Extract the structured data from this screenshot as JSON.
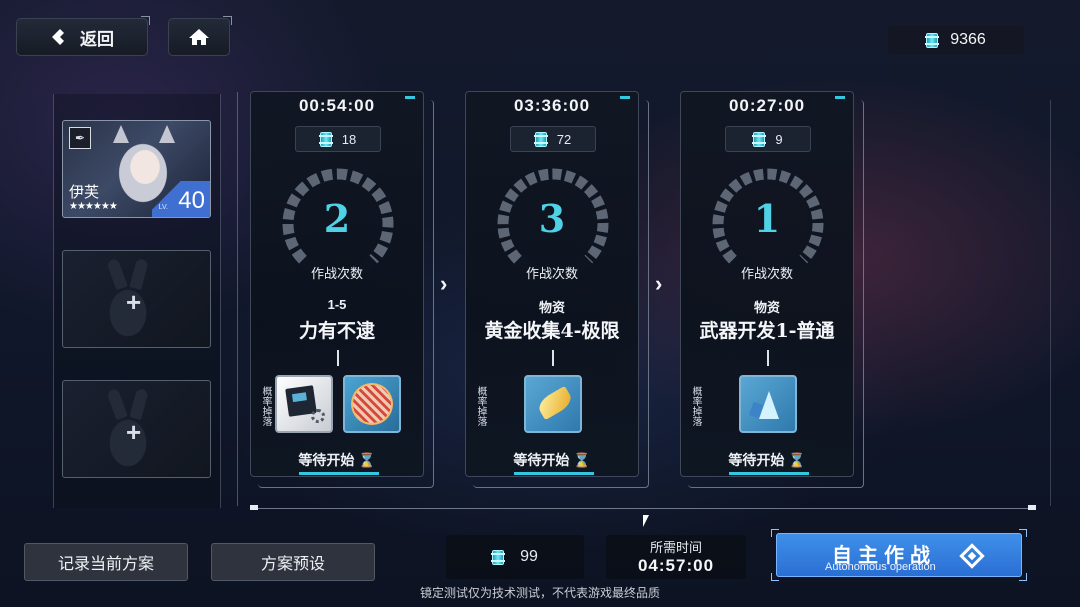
{
  "header": {
    "back_label": "返回",
    "back_icon": "diamond-back-icon",
    "home_icon": "home-icon",
    "currency_icon": "battery-can-icon",
    "currency_value": "9366"
  },
  "team": {
    "member": {
      "name": "伊芙",
      "level": "40",
      "lv_label": "LV.",
      "stars": "★★★★★★"
    },
    "empty_slot_label": "+"
  },
  "missions": [
    {
      "timer": "00:54:00",
      "cost": "18",
      "count": "2",
      "count_label": "作战次数",
      "stage_code": "1-5",
      "stage_name": "力有不逮",
      "drop_label": "概率掉落",
      "drops": [
        "gear-pad-icon",
        "red-chip-icon"
      ],
      "status": "等待开始"
    },
    {
      "timer": "03:36:00",
      "cost": "72",
      "count": "3",
      "count_label": "作战次数",
      "stage_code": "物资",
      "stage_name": "黄金收集4-极限",
      "drop_label": "概率掉落",
      "drops": [
        "gold-leaf-icon"
      ],
      "status": "等待开始"
    },
    {
      "timer": "00:27:00",
      "cost": "9",
      "count": "1",
      "count_label": "作战次数",
      "stage_code": "物资",
      "stage_name": "武器开发1-普通",
      "drop_label": "概率掉落",
      "drops": [
        "blue-crystal-icon"
      ],
      "status": "等待开始"
    }
  ],
  "bottom": {
    "record_label": "记录当前方案",
    "preset_label": "方案预设",
    "total_cost": "99",
    "time_label": "所需时间",
    "time_value": "04:57:00",
    "auto_cn": "自主作战",
    "auto_en": "Autonomous operation"
  },
  "disclaimer": "镜定测试仅为技术测试，不代表游戏最终品质",
  "colors": {
    "accent_cyan": "#4fd2e6",
    "button_blue": "#2a6fd3"
  }
}
